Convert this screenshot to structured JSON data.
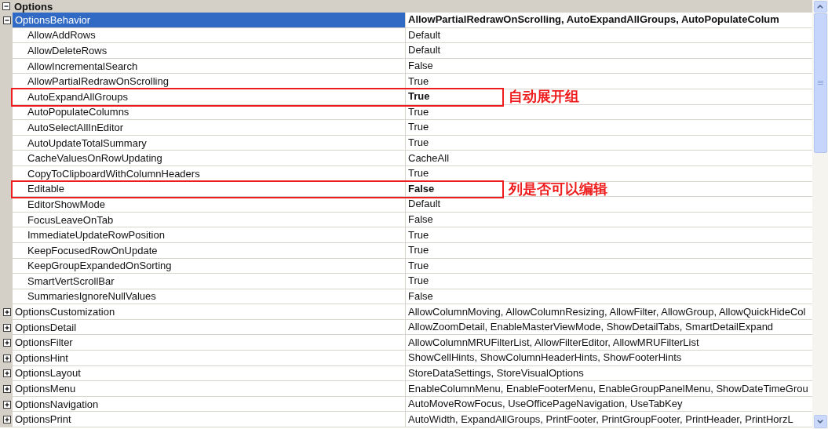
{
  "category": {
    "title": "Options",
    "expanded": true
  },
  "rows": [
    {
      "name": "OptionsBehavior",
      "value": "AllowPartialRedrawOnScrolling, AutoExpandAllGroups, AutoPopulateColum",
      "expanded": true,
      "selected": true,
      "modified": true,
      "children": [
        {
          "name": "AllowAddRows",
          "value": "Default",
          "selected": false,
          "modified": false
        },
        {
          "name": "AllowDeleteRows",
          "value": "Default",
          "selected": false,
          "modified": false
        },
        {
          "name": "AllowIncrementalSearch",
          "value": "False",
          "selected": false,
          "modified": false
        },
        {
          "name": "AllowPartialRedrawOnScrolling",
          "value": "True",
          "selected": false,
          "modified": false
        },
        {
          "name": "AutoExpandAllGroups",
          "value": "True",
          "selected": false,
          "modified": true,
          "annotation": "自动展开组"
        },
        {
          "name": "AutoPopulateColumns",
          "value": "True",
          "selected": false,
          "modified": false
        },
        {
          "name": "AutoSelectAllInEditor",
          "value": "True",
          "selected": false,
          "modified": false
        },
        {
          "name": "AutoUpdateTotalSummary",
          "value": "True",
          "selected": false,
          "modified": false
        },
        {
          "name": "CacheValuesOnRowUpdating",
          "value": "CacheAll",
          "selected": false,
          "modified": false
        },
        {
          "name": "CopyToClipboardWithColumnHeaders",
          "value": "True",
          "selected": false,
          "modified": false
        },
        {
          "name": "Editable",
          "value": "False",
          "selected": false,
          "modified": true,
          "annotation": "列是否可以编辑"
        },
        {
          "name": "EditorShowMode",
          "value": "Default",
          "selected": false,
          "modified": false
        },
        {
          "name": "FocusLeaveOnTab",
          "value": "False",
          "selected": false,
          "modified": false
        },
        {
          "name": "ImmediateUpdateRowPosition",
          "value": "True",
          "selected": false,
          "modified": false
        },
        {
          "name": "KeepFocusedRowOnUpdate",
          "value": "True",
          "selected": false,
          "modified": false
        },
        {
          "name": "KeepGroupExpandedOnSorting",
          "value": "True",
          "selected": false,
          "modified": false
        },
        {
          "name": "SmartVertScrollBar",
          "value": "True",
          "selected": false,
          "modified": false
        },
        {
          "name": "SummariesIgnoreNullValues",
          "value": "False",
          "selected": false,
          "modified": false
        }
      ]
    },
    {
      "name": "OptionsCustomization",
      "value": "AllowColumnMoving, AllowColumnResizing, AllowFilter, AllowGroup, AllowQuickHideCol",
      "expanded": false,
      "selected": false,
      "modified": false
    },
    {
      "name": "OptionsDetail",
      "value": "AllowZoomDetail, EnableMasterViewMode, ShowDetailTabs, SmartDetailExpand",
      "expanded": false,
      "selected": false,
      "modified": false
    },
    {
      "name": "OptionsFilter",
      "value": "AllowColumnMRUFilterList, AllowFilterEditor, AllowMRUFilterList",
      "expanded": false,
      "selected": false,
      "modified": false
    },
    {
      "name": "OptionsHint",
      "value": "ShowCellHints, ShowColumnHeaderHints, ShowFooterHints",
      "expanded": false,
      "selected": false,
      "modified": false
    },
    {
      "name": "OptionsLayout",
      "value": "StoreDataSettings, StoreVisualOptions",
      "expanded": false,
      "selected": false,
      "modified": false
    },
    {
      "name": "OptionsMenu",
      "value": "EnableColumnMenu, EnableFooterMenu, EnableGroupPanelMenu, ShowDateTimeGrou",
      "expanded": false,
      "selected": false,
      "modified": false
    },
    {
      "name": "OptionsNavigation",
      "value": "AutoMoveRowFocus, UseOfficePageNavigation, UseTabKey",
      "expanded": false,
      "selected": false,
      "modified": false
    },
    {
      "name": "OptionsPrint",
      "value": "AutoWidth, ExpandAllGroups, PrintFooter, PrintGroupFooter, PrintHeader, PrintHorzL",
      "expanded": false,
      "selected": false,
      "modified": false
    }
  ]
}
